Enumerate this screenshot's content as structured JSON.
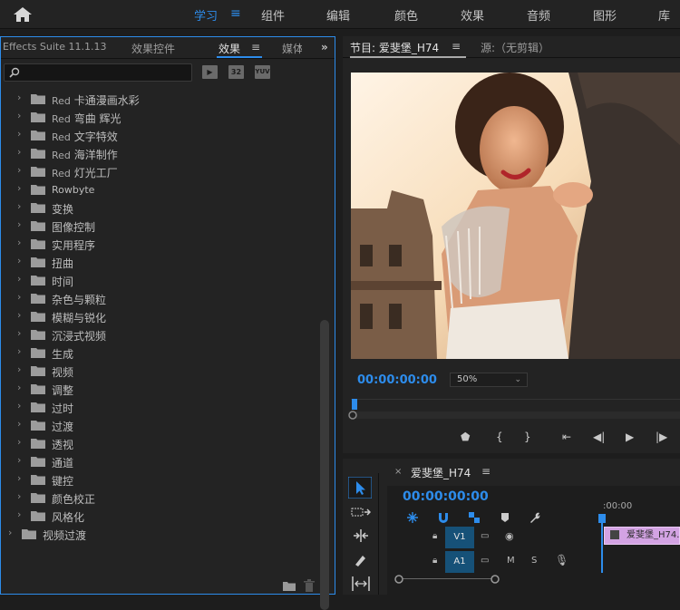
{
  "topbar": {
    "workspaces": [
      "学习",
      "组件",
      "编辑",
      "颜色",
      "效果",
      "音频",
      "图形",
      "库"
    ],
    "active_workspace": "学习",
    "accent": "#2d8ceb"
  },
  "effects_panel": {
    "tabs": {
      "suite": "Effects Suite 11.1.13",
      "effect_controls": "效果控件",
      "effects": "效果",
      "media": "媒体"
    },
    "search_placeholder": "",
    "filter_buttons": [
      "32",
      "YUV"
    ],
    "tree": [
      {
        "prefix": "Red",
        "name": "卡通漫画水彩",
        "level": 1
      },
      {
        "prefix": "Red",
        "name": "弯曲 辉光",
        "level": 1
      },
      {
        "prefix": "Red",
        "name": "文字特效",
        "level": 1
      },
      {
        "prefix": "Red",
        "name": "海洋制作",
        "level": 1
      },
      {
        "prefix": "Red",
        "name": "灯光工厂",
        "level": 1
      },
      {
        "prefix": "",
        "name": "Rowbyte",
        "level": 1
      },
      {
        "prefix": "",
        "name": "变换",
        "level": 1
      },
      {
        "prefix": "",
        "name": "图像控制",
        "level": 1
      },
      {
        "prefix": "",
        "name": "实用程序",
        "level": 1
      },
      {
        "prefix": "",
        "name": "扭曲",
        "level": 1
      },
      {
        "prefix": "",
        "name": "时间",
        "level": 1
      },
      {
        "prefix": "",
        "name": "杂色与颗粒",
        "level": 1
      },
      {
        "prefix": "",
        "name": "模糊与锐化",
        "level": 1
      },
      {
        "prefix": "",
        "name": "沉浸式视频",
        "level": 1
      },
      {
        "prefix": "",
        "name": "生成",
        "level": 1
      },
      {
        "prefix": "",
        "name": "视频",
        "level": 1
      },
      {
        "prefix": "",
        "name": "调整",
        "level": 1
      },
      {
        "prefix": "",
        "name": "过时",
        "level": 1
      },
      {
        "prefix": "",
        "name": "过渡",
        "level": 1
      },
      {
        "prefix": "",
        "name": "透视",
        "level": 1
      },
      {
        "prefix": "",
        "name": "通道",
        "level": 1
      },
      {
        "prefix": "",
        "name": "键控",
        "level": 1
      },
      {
        "prefix": "",
        "name": "颜色校正",
        "level": 1
      },
      {
        "prefix": "",
        "name": "风格化",
        "level": 1
      },
      {
        "prefix": "",
        "name": "视频过渡",
        "level": 0
      }
    ]
  },
  "program_monitor": {
    "tab_program": "节目: 爱斐堡_H74",
    "tab_source": "源:（无剪辑）",
    "timecode": "00:00:00:00",
    "zoom": "50%"
  },
  "timeline": {
    "sequence_name": "爱斐堡_H74",
    "timecode": "00:00:00:00",
    "ruler_label": ":00:00",
    "tracks": [
      {
        "id": "V1",
        "toggles": [
          "M",
          "S"
        ]
      },
      {
        "id": "A1",
        "toggles": [
          "M",
          "S"
        ]
      }
    ],
    "clip_name": "爱斐堡_H74.mp4",
    "clip_color": "#d3a3e3"
  }
}
